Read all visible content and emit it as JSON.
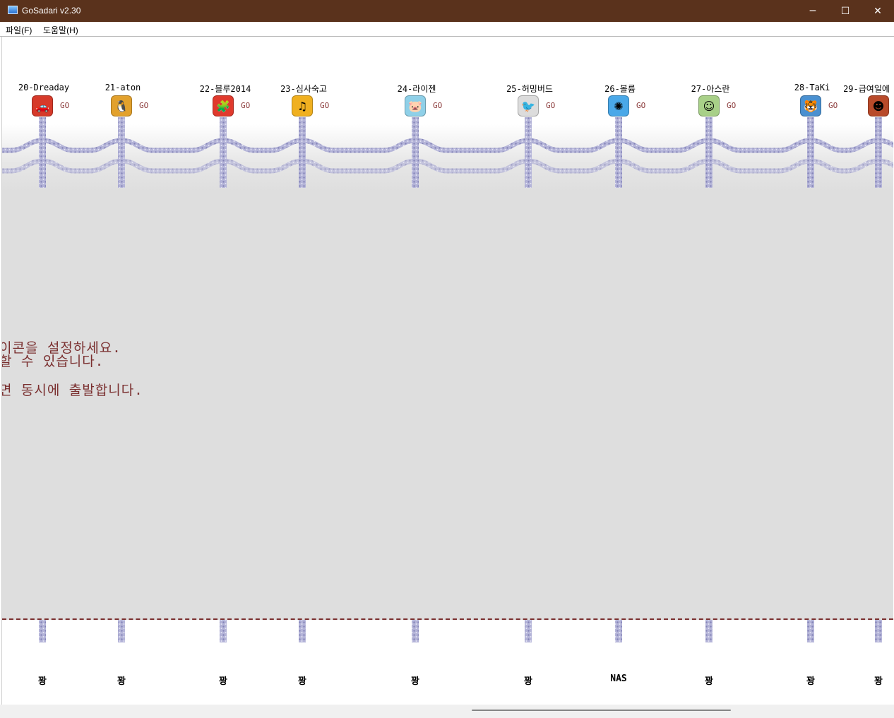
{
  "window": {
    "title": "GoSadari v2.30",
    "minimize_glyph": "─",
    "maximize_glyph": "☐",
    "close_glyph": "✕"
  },
  "menu": [
    {
      "label": "파일(F)"
    },
    {
      "label": "도움말(H)"
    }
  ],
  "go_label": "GO",
  "players": [
    {
      "name": "20-Dreaday",
      "icon": "cars-game-icon",
      "bg": "#d63a2a",
      "glyph": "🚗",
      "result": "꽝"
    },
    {
      "name": "21-aton",
      "icon": "penguin-game-icon",
      "bg": "#e2a12d",
      "glyph": "🐧",
      "result": "꽝"
    },
    {
      "name": "22-블루2014",
      "icon": "puzzle-game-icon",
      "bg": "#e03a2d",
      "glyph": "🧩",
      "result": "꽝"
    },
    {
      "name": "23-심사숙고",
      "icon": "music-note-icon",
      "bg": "#f0b020",
      "glyph": "♫",
      "result": "꽝"
    },
    {
      "name": "24-라이젠",
      "icon": "pig-game-icon",
      "bg": "#8fd0e8",
      "glyph": "🐷",
      "result": "꽝"
    },
    {
      "name": "25-허밍버드",
      "icon": "angry-bird-icon",
      "bg": "#dcdcdc",
      "glyph": "🐦",
      "result": "꽝"
    },
    {
      "name": "26-볼륨",
      "icon": "pinwheel-icon",
      "bg": "#4aa8e8",
      "glyph": "✺",
      "result": "NAS"
    },
    {
      "name": "27-아스란",
      "icon": "cartoon-face-icon",
      "bg": "#a8d088",
      "glyph": "☺",
      "result": "꽝"
    },
    {
      "name": "28-TaKi",
      "icon": "tiger-face-icon",
      "bg": "#4a90d0",
      "glyph": "🐯",
      "result": "꽝"
    },
    {
      "name": "29-급여일에",
      "icon": "character-face-icon",
      "bg": "#b84a2a",
      "glyph": "☻",
      "result": "꽝"
    }
  ],
  "messages": [
    "이콘을 설정하세요.",
    "할 수 있습니다.",
    "면 동시에 출발합니다."
  ]
}
